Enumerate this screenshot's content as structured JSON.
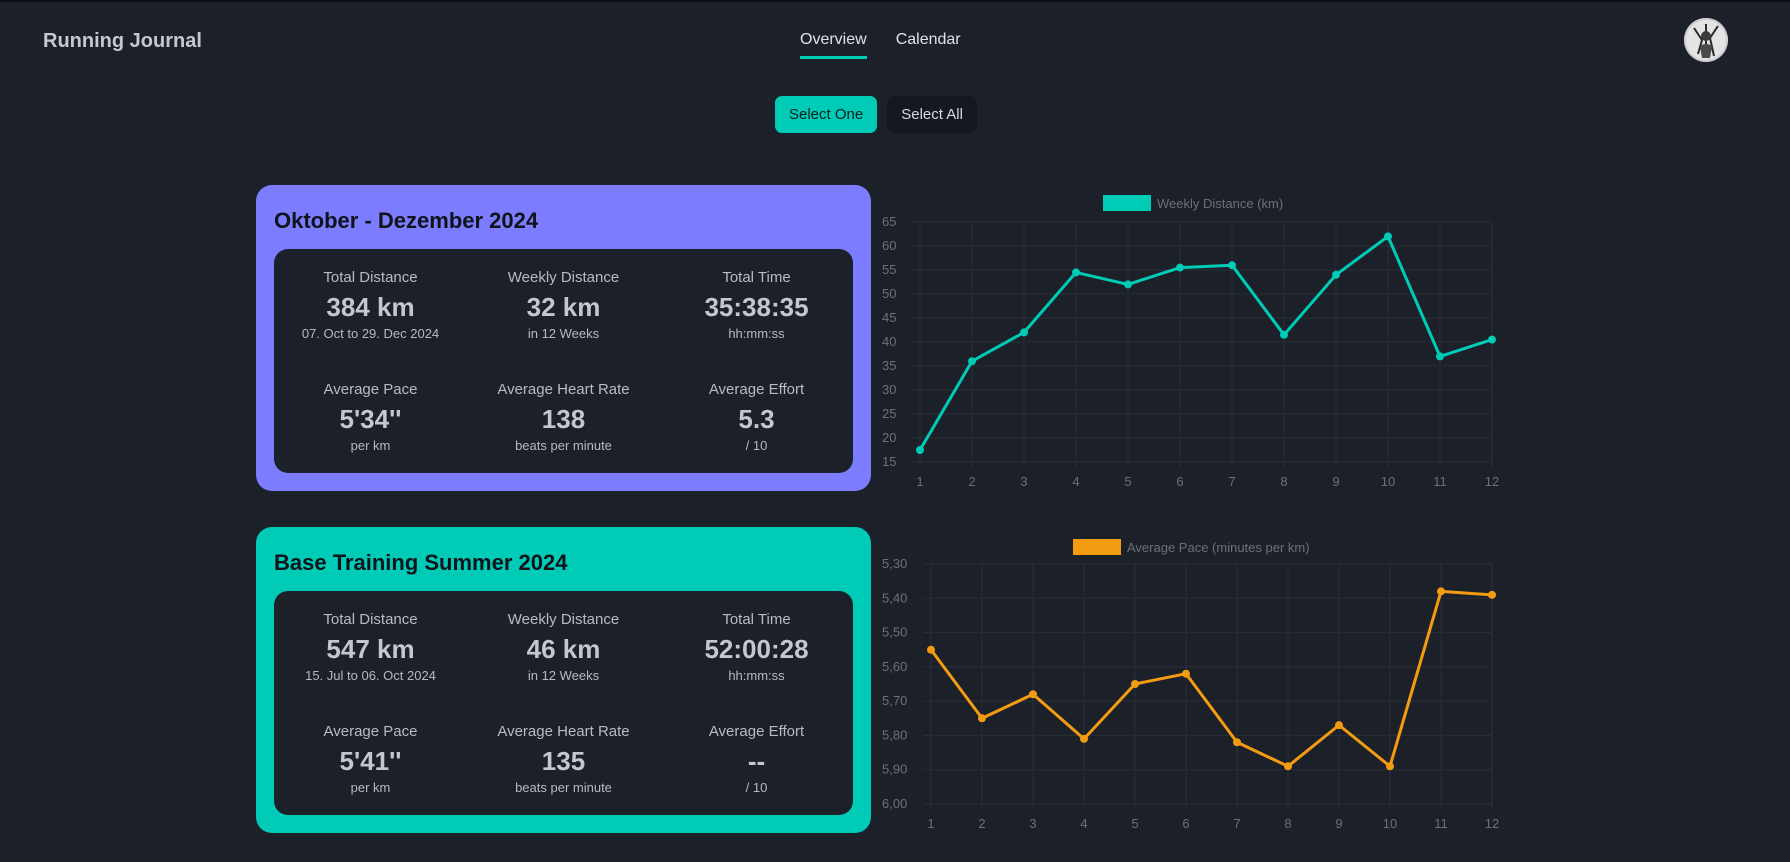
{
  "header": {
    "app_title": "Running Journal",
    "tabs": [
      {
        "label": "Overview",
        "active": true
      },
      {
        "label": "Calendar",
        "active": false
      }
    ]
  },
  "selection": {
    "select_one_label": "Select One",
    "select_all_label": "Select All"
  },
  "colors": {
    "accent": "#00cbb7",
    "card1_bg": "#7c7cff",
    "card2_bg": "#00cbb7",
    "pace_line": "#f39c12",
    "background": "#1c2129"
  },
  "cards": [
    {
      "title": "Oktober - Dezember 2024",
      "stats": {
        "total_distance_label": "Total Distance",
        "total_distance_value": "384 km",
        "total_distance_sub": "07. Oct to 29. Dec 2024",
        "weekly_distance_label": "Weekly Distance",
        "weekly_distance_value": "32 km",
        "weekly_distance_sub": "in 12 Weeks",
        "total_time_label": "Total Time",
        "total_time_value": "35:38:35",
        "total_time_sub": "hh:mm:ss",
        "avg_pace_label": "Average Pace",
        "avg_pace_value": "5'34''",
        "avg_pace_sub": "per km",
        "avg_hr_label": "Average Heart Rate",
        "avg_hr_value": "138",
        "avg_hr_sub": "beats per minute",
        "avg_effort_label": "Average Effort",
        "avg_effort_value": "5.3",
        "avg_effort_sub": "/ 10"
      }
    },
    {
      "title": "Base Training Summer 2024",
      "stats": {
        "total_distance_label": "Total Distance",
        "total_distance_value": "547 km",
        "total_distance_sub": "15. Jul to 06. Oct 2024",
        "weekly_distance_label": "Weekly Distance",
        "weekly_distance_value": "46 km",
        "weekly_distance_sub": "in 12 Weeks",
        "total_time_label": "Total Time",
        "total_time_value": "52:00:28",
        "total_time_sub": "hh:mm:ss",
        "avg_pace_label": "Average Pace",
        "avg_pace_value": "5'41''",
        "avg_pace_sub": "per km",
        "avg_hr_label": "Average Heart Rate",
        "avg_hr_value": "135",
        "avg_hr_sub": "beats per minute",
        "avg_effort_label": "Average Effort",
        "avg_effort_value": "--",
        "avg_effort_sub": "/ 10"
      }
    }
  ],
  "chart_data": [
    {
      "type": "line",
      "title": "",
      "x": [
        1,
        2,
        3,
        4,
        5,
        6,
        7,
        8,
        9,
        10,
        11,
        12
      ],
      "series": [
        {
          "name": "Weekly Distance (km)",
          "color": "#00cbb7",
          "values": [
            17.5,
            36,
            42,
            54.5,
            52,
            55.5,
            56,
            41.5,
            54,
            62,
            37,
            40.5
          ]
        }
      ],
      "ylim": [
        15,
        65
      ],
      "yticks": [
        "15",
        "20",
        "25",
        "30",
        "35",
        "40",
        "45",
        "50",
        "55",
        "60",
        "65"
      ],
      "y_reversed": false,
      "grid": true,
      "legend": "top-center"
    },
    {
      "type": "line",
      "title": "",
      "x": [
        1,
        2,
        3,
        4,
        5,
        6,
        7,
        8,
        9,
        10,
        11,
        12
      ],
      "series": [
        {
          "name": "Average Pace (minutes per km)",
          "color": "#f39c12",
          "values": [
            5.55,
            5.75,
            5.68,
            5.81,
            5.65,
            5.62,
            5.82,
            5.89,
            5.77,
            5.89,
            5.38,
            5.39
          ]
        }
      ],
      "ylim": [
        5.3,
        6.0
      ],
      "yticks": [
        "5,30",
        "5,40",
        "5,50",
        "5,60",
        "5,70",
        "5,80",
        "5,90",
        "6,00"
      ],
      "y_reversed": true,
      "grid": true,
      "legend": "top-center"
    }
  ]
}
